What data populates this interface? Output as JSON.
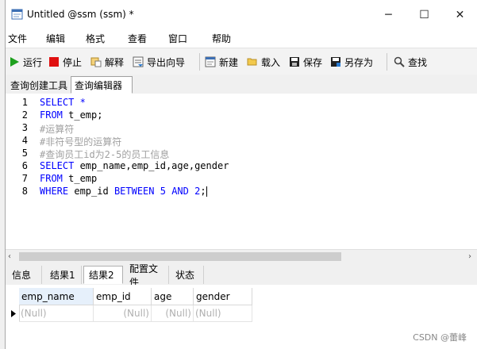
{
  "window": {
    "title": "Untitled @ssm (ssm) *"
  },
  "window_controls": {
    "minimize": "─",
    "maximize": "☐",
    "close": "✕"
  },
  "menu": [
    "文件",
    "编辑",
    "格式",
    "查看",
    "窗口",
    "帮助"
  ],
  "toolbar": {
    "run": "运行",
    "stop": "停止",
    "explain": "解释",
    "export_wizard": "导出向导",
    "new": "新建",
    "load": "载入",
    "save": "保存",
    "save_as": "另存为",
    "find": "查找"
  },
  "tabs": [
    "查询创建工具",
    "查询编辑器"
  ],
  "editor": {
    "line_numbers": [
      "1",
      "2",
      "3",
      "4",
      "5",
      "6",
      "7",
      "8"
    ],
    "lines": [
      [
        {
          "t": "SELECT *",
          "c": "kw"
        }
      ],
      [
        {
          "t": "FROM ",
          "c": "kw"
        },
        {
          "t": "t_emp;",
          "c": "tx"
        }
      ],
      [
        {
          "t": "#运算符",
          "c": "cm"
        }
      ],
      [
        {
          "t": "#非符号型的运算符",
          "c": "cm"
        }
      ],
      [
        {
          "t": "#查询员工id为2-5的员工信息",
          "c": "cm"
        }
      ],
      [
        {
          "t": "SELECT ",
          "c": "kw"
        },
        {
          "t": "emp_name,emp_id,age,gender",
          "c": "tx"
        }
      ],
      [
        {
          "t": "FROM ",
          "c": "kw"
        },
        {
          "t": "t_emp",
          "c": "tx"
        }
      ],
      [
        {
          "t": "WHERE ",
          "c": "kw"
        },
        {
          "t": "emp_id ",
          "c": "tx"
        },
        {
          "t": "BETWEEN ",
          "c": "kw"
        },
        {
          "t": "5 ",
          "c": "nm"
        },
        {
          "t": "AND ",
          "c": "kw"
        },
        {
          "t": "2",
          "c": "nm"
        },
        {
          "t": ";",
          "c": "tx"
        }
      ]
    ]
  },
  "result_tabs": [
    "信息",
    "结果1",
    "结果2",
    "配置文件",
    "状态"
  ],
  "result_grid": {
    "columns": [
      "emp_name",
      "emp_id",
      "age",
      "gender"
    ],
    "row": [
      "(Null)",
      "(Null)",
      "(Null)",
      "(Null)"
    ]
  },
  "watermark": "CSDN @蕾峰"
}
